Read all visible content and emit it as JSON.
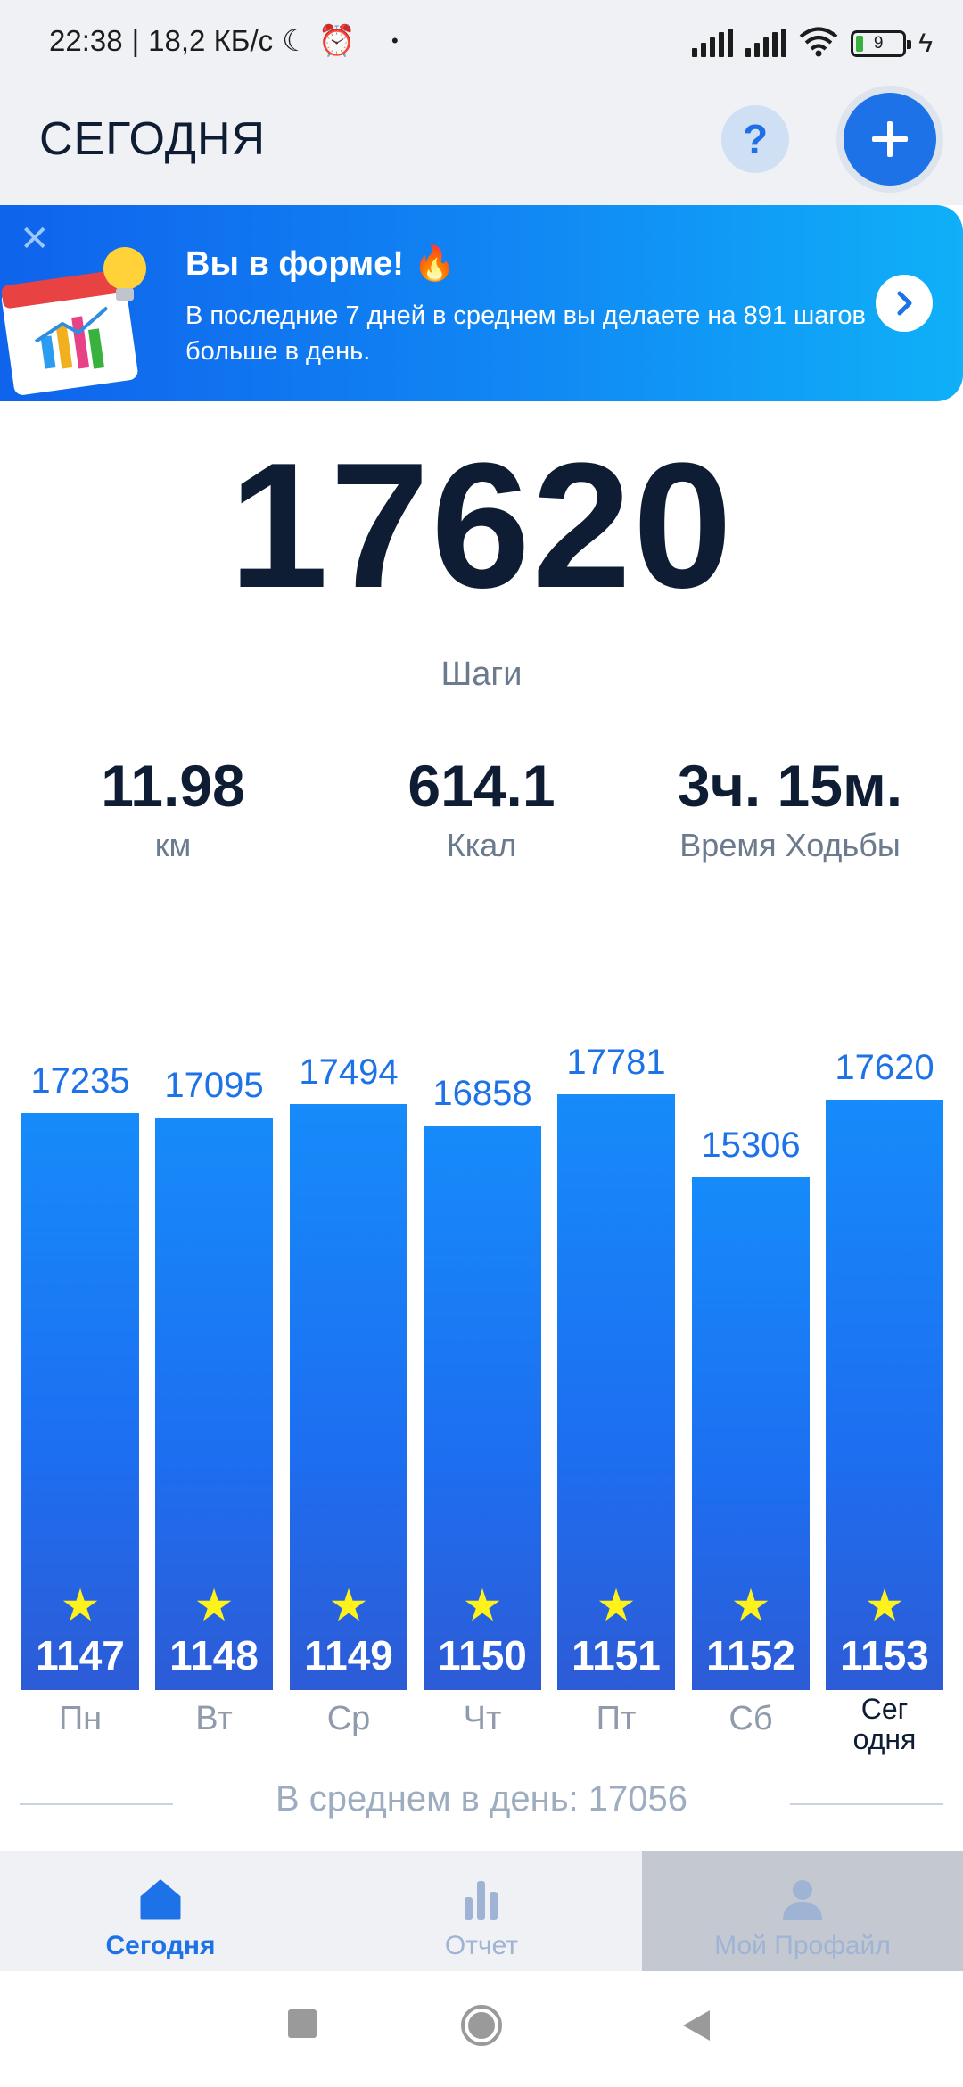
{
  "status_bar": {
    "time": "22:38",
    "separator": "|",
    "net_speed": "18,2 КБ/с",
    "moon_icon": "moon-icon",
    "alarm_icon": "alarm-icon",
    "dot": "•",
    "battery_level": "9"
  },
  "header": {
    "title": "СЕГОДНЯ",
    "help_label": "?",
    "add_icon": "plus-icon"
  },
  "banner": {
    "title": "Вы в форме! 🔥",
    "text": "В последние 7 дней в среднем вы делаете на 891 шагов больше в день.",
    "close_icon": "close-icon",
    "arrow_icon": "chevron-right-icon"
  },
  "summary": {
    "steps": "17620",
    "steps_label": "Шаги",
    "distance": "11.98",
    "distance_label": "км",
    "calories": "614.1",
    "calories_label": "Ккал",
    "walk_time": "3ч. 15м.",
    "walk_time_label": "Время Ходьбы"
  },
  "chart_data": {
    "type": "bar",
    "categories": [
      "Пн",
      "Вт",
      "Ср",
      "Чт",
      "Пт",
      "Сб",
      "Сег\nодня"
    ],
    "values": [
      17235,
      17095,
      17494,
      16858,
      17781,
      15306,
      17620
    ],
    "bar_numbers": [
      "1147",
      "1148",
      "1149",
      "1150",
      "1151",
      "1152",
      "1153"
    ],
    "bar_color": "#1d72e8",
    "star_color": "#fff21a"
  },
  "average": {
    "label": "В среднем в день: 17056"
  },
  "bottom_nav": [
    {
      "label": "Сегодня",
      "icon": "home-icon",
      "color": "#1d72e8"
    },
    {
      "label": "Отчет",
      "icon": "bar-chart-icon",
      "color": "#9fb3d4"
    },
    {
      "label": "Мой Профайл",
      "icon": "profile-icon",
      "color": "#9fb3d4"
    }
  ],
  "system_nav": {
    "recents_icon": "square-icon",
    "home_icon": "circle-home-icon",
    "back_icon": "triangle-back-icon"
  }
}
